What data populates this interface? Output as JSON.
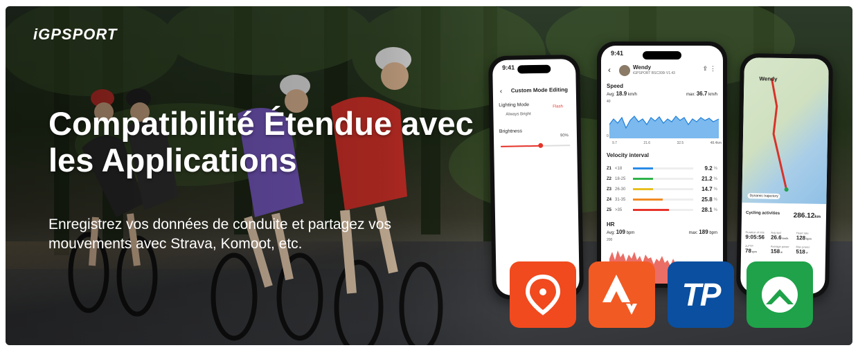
{
  "brand": {
    "logo": "iGPSPORT"
  },
  "headline": {
    "title": "Compatibilité Étendue avec les Applications",
    "subtitle": "Enregistrez vos données de conduite et partagez vos mouvements avec Strava, Komoot, etc."
  },
  "phone_left": {
    "time": "9:41",
    "header": "Custom Mode Editing",
    "lighting_label": "Lighting Mode",
    "option_1": "Always Bright",
    "option_2": "Flash",
    "brightness_label": "Brightness",
    "brightness_value": "90%"
  },
  "phone_center": {
    "time": "9:41",
    "user": "Wendy",
    "device": "iGPSPORT BSC300i  V1.43",
    "speed_label": "Speed",
    "speed_avg_label": "Avg:",
    "speed_avg": "18.9",
    "speed_unit": "km/h",
    "speed_max_label": "max:",
    "speed_max": "36.7",
    "velocity_label": "Velocity interval",
    "zones": [
      {
        "zone": "Z1",
        "range": "<18",
        "value": "9.2",
        "color": "#2a8be6",
        "frac": 0.33
      },
      {
        "zone": "Z2",
        "range": "18-25",
        "value": "21.2",
        "color": "#2fb34a",
        "frac": 0.33
      },
      {
        "zone": "Z3",
        "range": "26-30",
        "value": "14.7",
        "color": "#e8c01f",
        "frac": 0.33
      },
      {
        "zone": "Z4",
        "range": "31-35",
        "value": "25.8",
        "color": "#f08a22",
        "frac": 0.5
      },
      {
        "zone": "Z5",
        "range": ">35",
        "value": "28.1",
        "color": "#e6332a",
        "frac": 0.6
      }
    ],
    "percent": "%",
    "hr_label": "HR",
    "hr_avg_label": "Avg:",
    "hr_avg": "109",
    "hr_unit": "bpm",
    "hr_max_label": "max:",
    "hr_max": "189",
    "axis_top": "40",
    "axis_mid": "0",
    "hr_axis": "200",
    "x_ticks": [
      "9.7",
      "21.6",
      "32.5",
      "48.4km"
    ]
  },
  "phone_right": {
    "user": "Wendy",
    "dynamic": "Dynamic trajectory",
    "activity_label": "Cycling activities",
    "activity_value": "286.12",
    "activity_unit": "km",
    "stats": [
      {
        "label": "Duration of ride",
        "value": "9:05:56"
      },
      {
        "label": "Avg spd",
        "value": "26.6",
        "unit": "km/h"
      },
      {
        "label": "Heart rate",
        "value": "128",
        "unit": "bpm"
      },
      {
        "label": "A-FTP",
        "value": "78",
        "unit": "rpm"
      },
      {
        "label": "Average power",
        "value": "158",
        "unit": "w"
      },
      {
        "label": "Max power",
        "value": "518",
        "unit": "w"
      }
    ]
  },
  "apps": [
    {
      "name": "Komoot",
      "color": "#f04a1e"
    },
    {
      "name": "Strava",
      "color": "#f25a23"
    },
    {
      "name": "TrainingPeaks",
      "label": "TP",
      "color": "#0a4fa0"
    },
    {
      "name": "Komoot-green",
      "color": "#1fa249"
    }
  ]
}
